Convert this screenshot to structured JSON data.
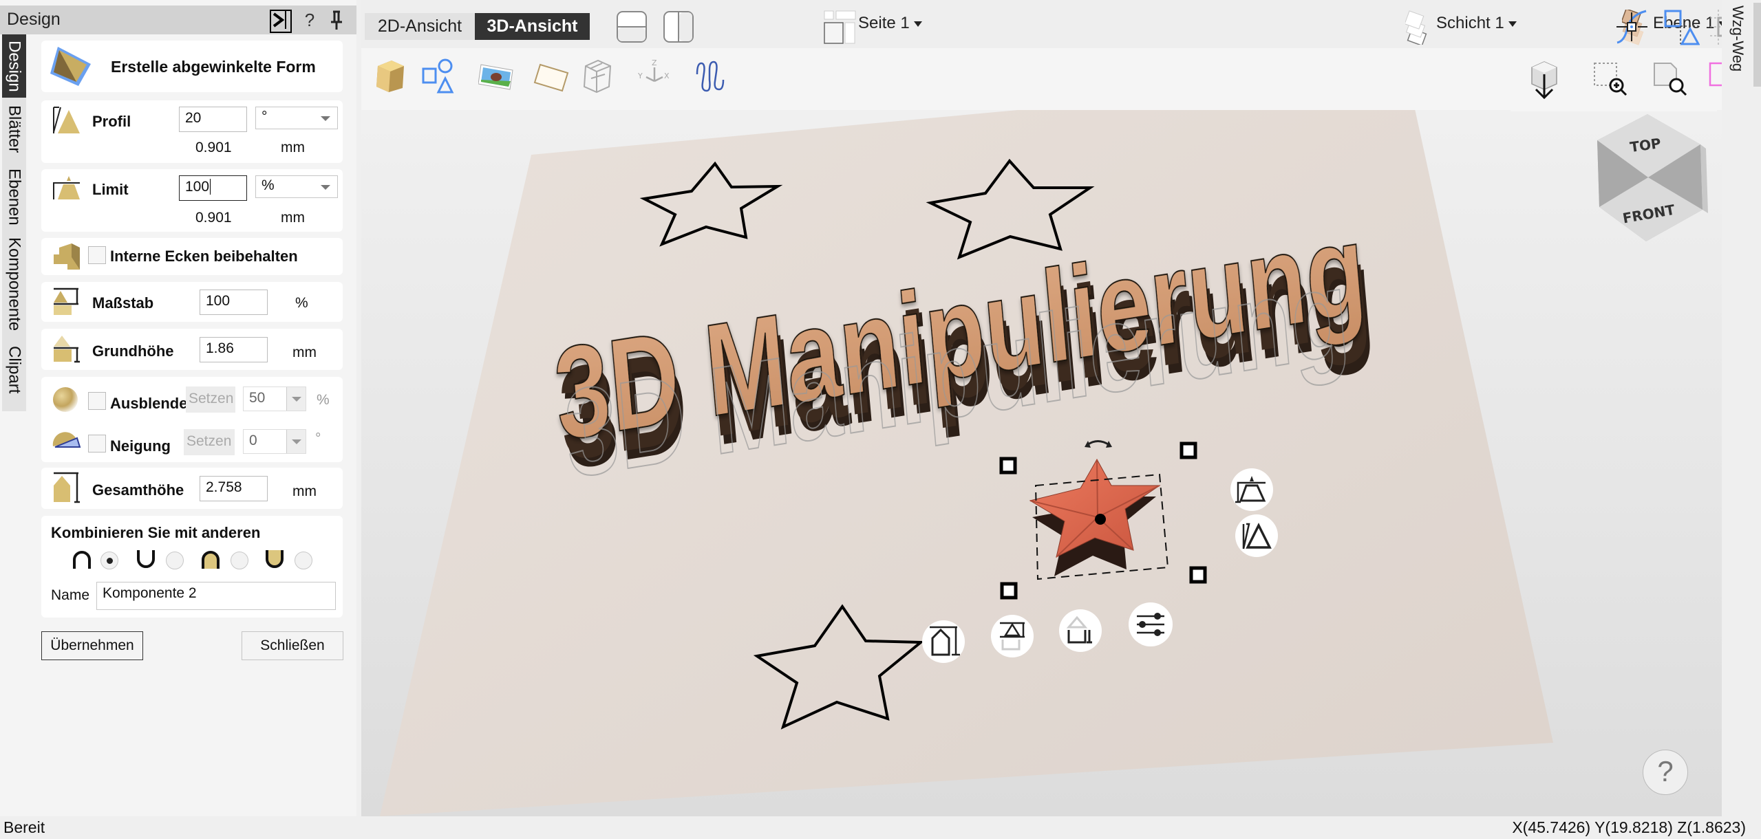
{
  "panel": {
    "title": "Design",
    "header_buttons": {
      "collapse": "collapse-panel",
      "help": "?",
      "pin": "pin"
    },
    "vertical_tabs": [
      {
        "label": "Design",
        "active": true
      },
      {
        "label": "Blätter",
        "active": false
      },
      {
        "label": "Ebenen",
        "active": false
      },
      {
        "label": "Komponente",
        "active": false
      },
      {
        "label": "Clipart",
        "active": false
      }
    ],
    "tool_title": "Erstelle abgewinkelte Form",
    "profil": {
      "label": "Profil",
      "value": "20",
      "unit_select": "°",
      "computed": "0.901",
      "computed_unit": "mm"
    },
    "limit": {
      "label": "Limit",
      "value": "100",
      "unit_select": "%",
      "computed": "0.901",
      "computed_unit": "mm"
    },
    "interne_ecken": {
      "label": "Interne Ecken beibehalten",
      "checked": false
    },
    "massstab": {
      "label": "Maßstab",
      "value": "100",
      "unit": "%"
    },
    "grundhoehe": {
      "label": "Grundhöhe",
      "value": "1.86",
      "unit": "mm"
    },
    "ausblenden": {
      "label": "Ausblende",
      "checked": false,
      "set_label": "Setzen",
      "value": "50",
      "unit": "%"
    },
    "neigung": {
      "label": "Neigung",
      "checked": false,
      "set_label": "Setzen",
      "value": "0",
      "unit": "°"
    },
    "gesamthoehe": {
      "label": "Gesamthöhe",
      "value": "2.758",
      "unit": "mm"
    },
    "combine": {
      "title": "Kombinieren Sie mit anderen",
      "options": [
        {
          "icon": "intersect-arch-icon",
          "selected": true
        },
        {
          "icon": "union-cup-icon",
          "selected": false
        },
        {
          "icon": "filled-arch-icon",
          "selected": false
        },
        {
          "icon": "filled-cup-icon",
          "selected": false
        }
      ],
      "name_label": "Name",
      "name_value": "Komponente 2"
    },
    "apply_label": "Übernehmen",
    "close_label": "Schließen"
  },
  "viewport": {
    "tabs": [
      {
        "label": "2D-Ansicht",
        "active": false
      },
      {
        "label": "3D-Ansicht",
        "active": true
      }
    ],
    "dropdowns": {
      "page": "Seite 1",
      "layer": "Schicht 1",
      "level": "Ebene 1"
    },
    "toolbar_icons": [
      "solid-cube-icon",
      "shapes-icon",
      "image-icon",
      "paper-icon",
      "wireframe-cube-icon",
      "axes-icon",
      "wave-pattern-icon"
    ],
    "top_right_icons": [
      "snap-node-icon",
      "align-shapes-icon",
      "grid-icon"
    ],
    "view_icons": [
      "view-down-icon",
      "zoom-selection-icon",
      "zoom-page-icon",
      "zoom-object-icon"
    ],
    "viewcube": {
      "top": "TOP",
      "front": "FRONT"
    },
    "scene_text": "3D Manipulierung",
    "help_label": "?"
  },
  "right_strip": {
    "tab_label": "Wzg-Weg"
  },
  "status": {
    "text": "Bereit",
    "coords": "X(45.7426) Y(19.8218) Z(1.8623)"
  },
  "colors": {
    "accent_dark": "#333333",
    "gold": "#c8ad62",
    "paper": "#e4dcd6",
    "star_fill": "#e0684e",
    "text_copper": "#d6a07a"
  }
}
